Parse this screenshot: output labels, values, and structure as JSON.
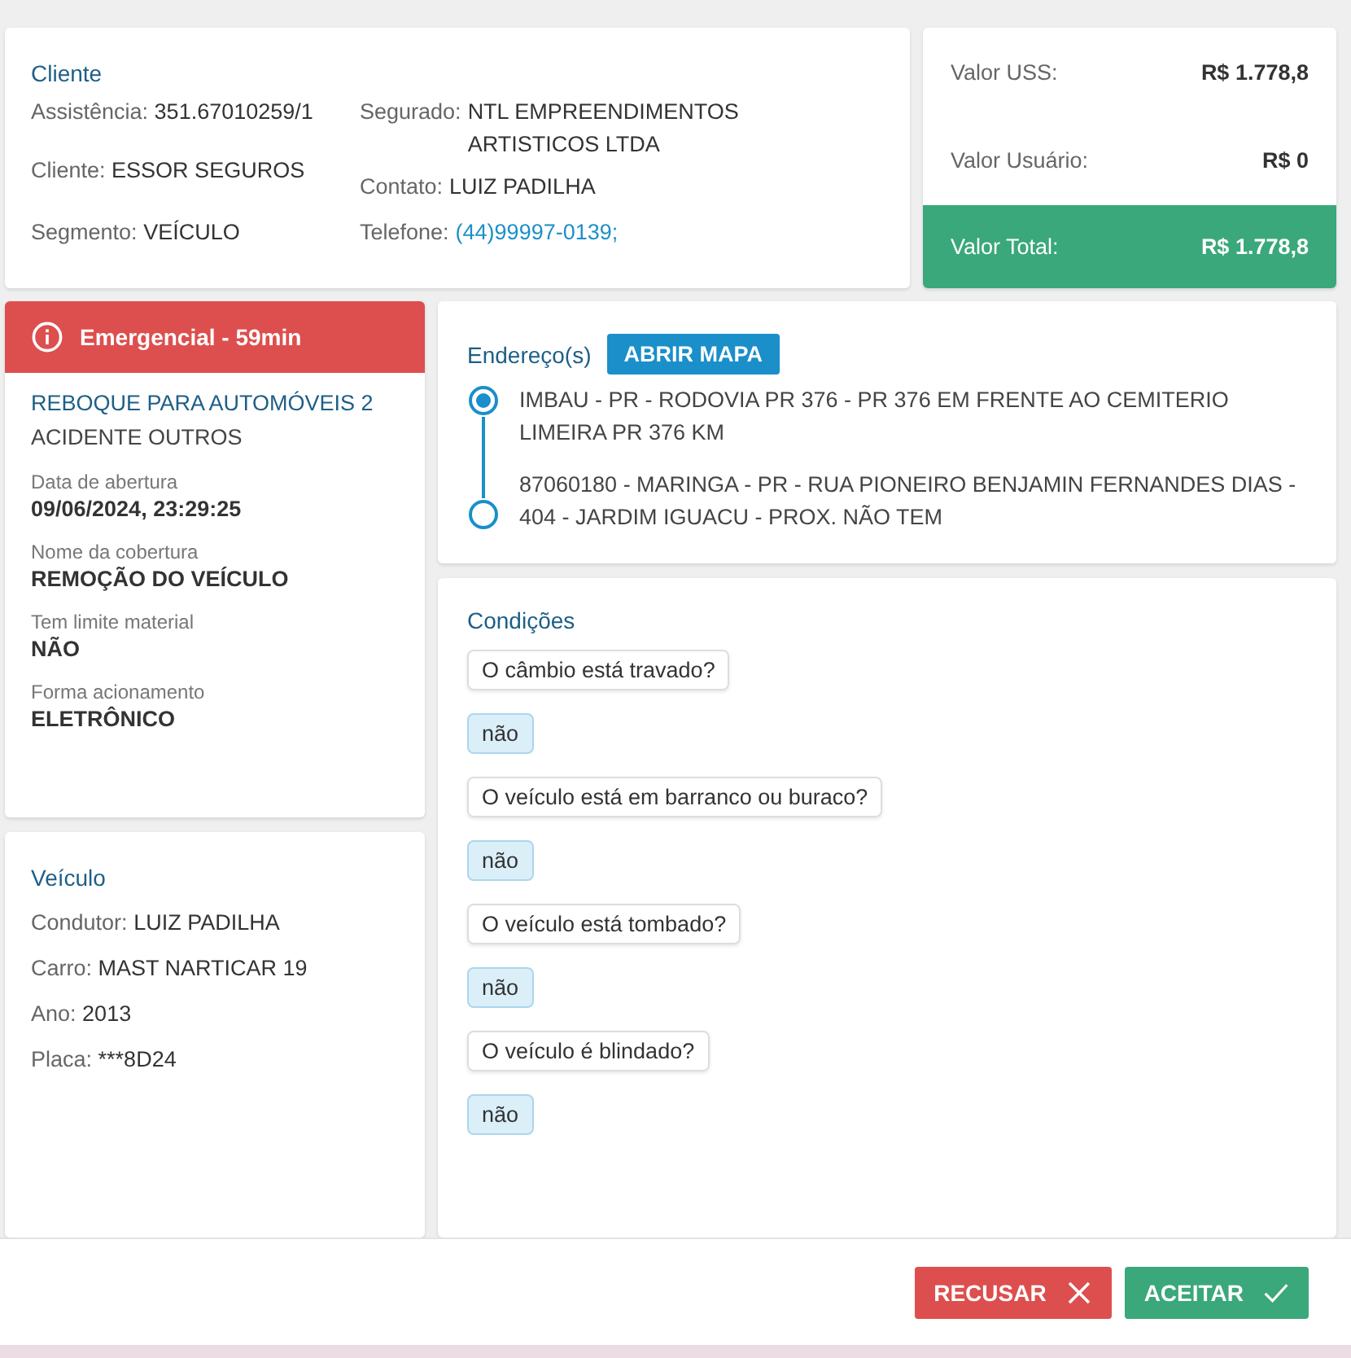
{
  "client": {
    "title": "Cliente",
    "left_fields": [
      {
        "label": "Assistência:",
        "value": "351.67010259/1"
      },
      {
        "label": "Cliente:",
        "value": "ESSOR SEGUROS"
      },
      {
        "label": "Segmento:",
        "value": "VEÍCULO"
      }
    ],
    "right_fields": [
      {
        "label": "Segurado:",
        "value": "NTL EMPREENDIMENTOS ARTISTICOS LTDA",
        "kind": "text"
      },
      {
        "label": "Contato:",
        "value": "LUIZ PADILHA",
        "kind": "text"
      },
      {
        "label": "Telefone:",
        "value": "(44)99997-0139;",
        "kind": "link"
      }
    ]
  },
  "values": [
    {
      "label": "Valor USS:",
      "value": "R$ 1.778,8",
      "kind": "normal"
    },
    {
      "label": "Valor Usuário:",
      "value": "R$ 0",
      "kind": "normal"
    },
    {
      "label": "Valor Total:",
      "value": "R$ 1.778,8",
      "kind": "total"
    }
  ],
  "service": {
    "alert": "Emergencial - 59min",
    "title": "REBOQUE PARA AUTOMÓVEIS 2",
    "subtitle": "ACIDENTE OUTROS",
    "details": [
      {
        "label": "Data de abertura",
        "value": "09/06/2024, 23:29:25"
      },
      {
        "label": "Nome da cobertura",
        "value": "REMOÇÃO DO VEÍCULO"
      },
      {
        "label": "Tem limite material",
        "value": "NÃO"
      },
      {
        "label": "Forma acionamento",
        "value": "ELETRÔNICO"
      }
    ]
  },
  "vehicle": {
    "title": "Veículo",
    "fields": [
      {
        "label": "Condutor:",
        "value": "LUIZ PADILHA"
      },
      {
        "label": "Carro:",
        "value": "MAST NARTICAR 19"
      },
      {
        "label": "Ano:",
        "value": "2013"
      },
      {
        "label": "Placa:",
        "value": "***8D24"
      }
    ]
  },
  "addresses": {
    "title": "Endereço(s)",
    "button": "ABRIR MAPA",
    "items": [
      {
        "text": "IMBAU - PR - RODOVIA PR 376 - PR 376 EM FRENTE AO CEMITERIO LIMEIRA PR 376 KM",
        "kind": "origin"
      },
      {
        "text": "87060180 - MARINGA - PR - RUA PIONEIRO BENJAMIN FERNANDES DIAS - 404 - JARDIM IGUACU - PROX. NÃO TEM",
        "kind": "destination"
      }
    ]
  },
  "conditions": {
    "title": "Condições",
    "items": [
      {
        "question": "O câmbio está travado?",
        "answer": "não"
      },
      {
        "question": "O veículo está em barranco ou buraco?",
        "answer": "não"
      },
      {
        "question": "O veículo está tombado?",
        "answer": "não"
      },
      {
        "question": "O veículo é blindado?",
        "answer": "não"
      }
    ]
  },
  "actions": [
    {
      "label": "RECUSAR",
      "kind": "reject"
    },
    {
      "label": "ACEITAR",
      "kind": "accept"
    }
  ]
}
